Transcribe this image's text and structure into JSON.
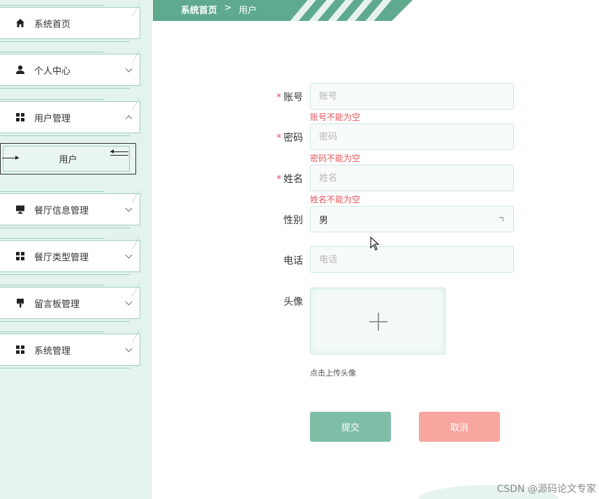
{
  "sidebar": {
    "items": [
      {
        "label": "系统首页",
        "icon": "home-icon"
      },
      {
        "label": "个人中心",
        "icon": "user-icon"
      },
      {
        "label": "用户管理",
        "icon": "grid-icon"
      },
      {
        "label": "餐厅信息管理",
        "icon": "monitor-icon"
      },
      {
        "label": "餐厅类型管理",
        "icon": "grid-icon"
      },
      {
        "label": "留言板管理",
        "icon": "brush-icon"
      },
      {
        "label": "系统管理",
        "icon": "grid-icon"
      }
    ],
    "sub_item": "用户"
  },
  "breadcrumb": {
    "home": "系统首页",
    "sep": ">",
    "current": "用户"
  },
  "form": {
    "account": {
      "label": "账号",
      "placeholder": "账号",
      "error": "账号不能为空"
    },
    "password": {
      "label": "密码",
      "placeholder": "密码",
      "error": "密码不能为空"
    },
    "name": {
      "label": "姓名",
      "placeholder": "姓名",
      "error": "姓名不能为空"
    },
    "gender": {
      "label": "性别",
      "value": "男"
    },
    "phone": {
      "label": "电话",
      "placeholder": "电话"
    },
    "avatar": {
      "label": "头像",
      "hint": "点击上传头像"
    },
    "required_mark": "*"
  },
  "buttons": {
    "submit": "提交",
    "cancel": "取消"
  },
  "watermark": "CSDN @源码论文专家",
  "colors": {
    "primary": "#5fa98e",
    "danger": "#e0565b",
    "cancel": "#f7a6a0"
  }
}
